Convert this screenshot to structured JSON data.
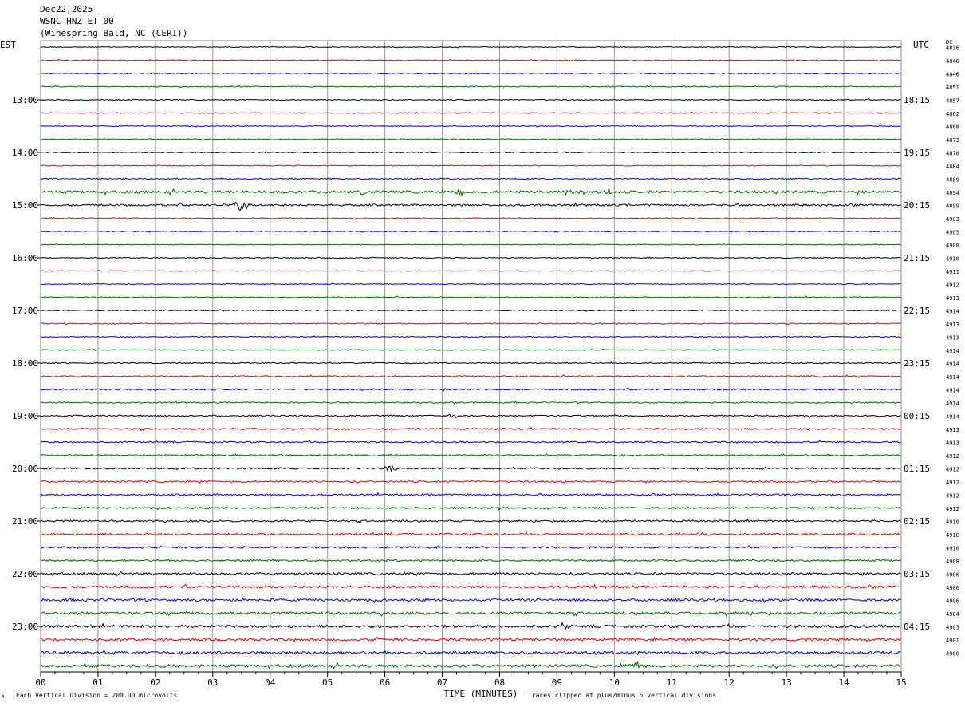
{
  "header": {
    "date": "Dec22,2025",
    "station": "WSNC HNZ ET 00",
    "location": "(Winespring Bald, NC (CERI))"
  },
  "left_zone": "EST",
  "right_zone": "UTC",
  "dc_label": "DC",
  "footer": {
    "scale_note": "Each Vertical Division =  200.00 microvolts",
    "clip_note": "Traces clipped at plus/minus 5 vertical divisions",
    "mark": "A"
  },
  "chart_data": {
    "type": "line",
    "title": "",
    "xlabel": "TIME (MINUTES)",
    "ylabel": "",
    "xlim": [
      0,
      15
    ],
    "x_ticks": [
      "00",
      "01",
      "02",
      "03",
      "04",
      "05",
      "06",
      "07",
      "08",
      "09",
      "10",
      "11",
      "12",
      "13",
      "14",
      "15"
    ],
    "trace_colors": [
      "#000000",
      "#e00000",
      "#0000cc",
      "#006600"
    ],
    "traces_per_hour": 4,
    "trace_count": 48,
    "left_hour_labels": [
      "13:00",
      "14:00",
      "15:00",
      "16:00",
      "17:00",
      "18:00",
      "19:00",
      "20:00",
      "21:00",
      "22:00",
      "23:00"
    ],
    "left_hour_first_trace": [
      4,
      8,
      12,
      16,
      20,
      24,
      28,
      32,
      36,
      40,
      44
    ],
    "right_hour_labels": [
      "18:15",
      "19:15",
      "20:15",
      "21:15",
      "22:15",
      "23:15",
      "00:15",
      "01:15",
      "02:15",
      "03:15",
      "04:15"
    ],
    "dc_offsets": [
      "4836",
      "4840",
      "4846",
      "4851",
      "4857",
      "4862",
      "4868",
      "4873",
      "4878",
      "4884",
      "4889",
      "4894",
      "4899",
      "4903",
      "4905",
      "4908",
      "4910",
      "4911",
      "4912",
      "4913",
      "4914",
      "4913",
      "4913",
      "4914",
      "4914",
      "4914",
      "4914",
      "4914",
      "4914",
      "4913",
      "4913",
      "4912",
      "4912",
      "4912",
      "4912",
      "4912",
      "4910",
      "4910",
      "4910",
      "4908",
      "4906",
      "4906",
      "4906",
      "4904",
      "4903",
      "4901",
      "4900"
    ],
    "noise_level": [
      0.5,
      0.5,
      0.5,
      0.6,
      0.6,
      0.6,
      0.5,
      0.6,
      0.6,
      0.5,
      0.7,
      1.6,
      1.2,
      0.6,
      0.5,
      0.5,
      0.6,
      0.5,
      0.5,
      0.6,
      0.6,
      0.6,
      0.6,
      0.6,
      0.7,
      0.8,
      0.9,
      0.8,
      0.9,
      1.0,
      0.9,
      0.9,
      1.0,
      1.0,
      1.1,
      1.0,
      1.1,
      1.2,
      1.1,
      1.1,
      1.3,
      1.4,
      1.5,
      1.6,
      1.6,
      1.5,
      1.7,
      1.7
    ],
    "events": [
      {
        "trace": 11,
        "minute": 5.6,
        "amp": 6
      },
      {
        "trace": 11,
        "minute": 7.3,
        "amp": 6
      },
      {
        "trace": 11,
        "minute": 9.2,
        "amp": 7
      },
      {
        "trace": 11,
        "minute": 9.9,
        "amp": 6
      },
      {
        "trace": 12,
        "minute": 3.5,
        "amp": 14
      },
      {
        "trace": 28,
        "minute": 7.2,
        "amp": 4
      },
      {
        "trace": 32,
        "minute": 6.1,
        "amp": 7
      },
      {
        "trace": 37,
        "minute": 11.6,
        "amp": 6
      },
      {
        "trace": 44,
        "minute": 9.1,
        "amp": 5
      },
      {
        "trace": 47,
        "minute": 10.4,
        "amp": 5
      }
    ]
  }
}
